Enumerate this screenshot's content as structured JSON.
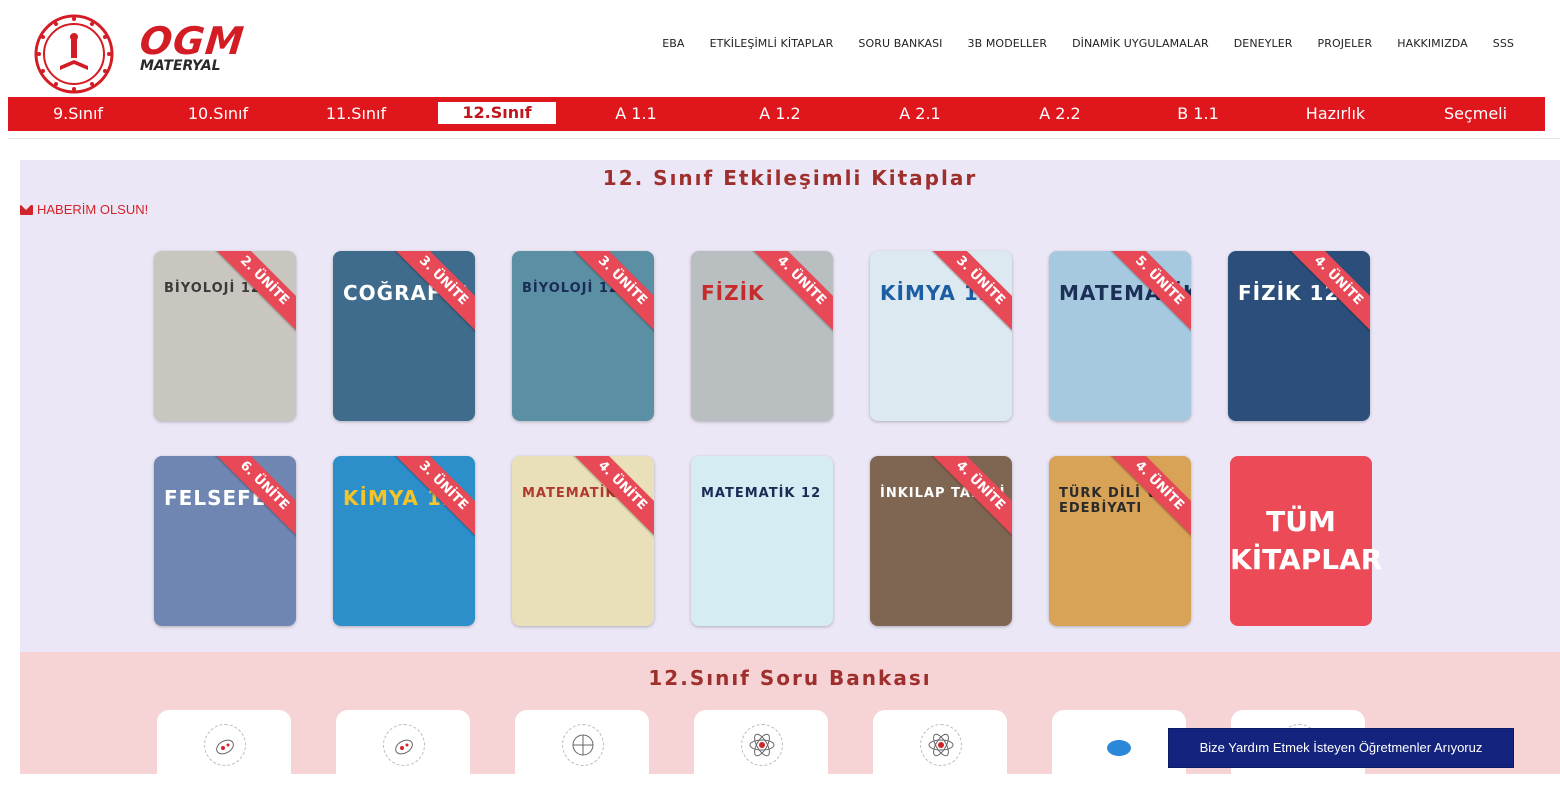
{
  "brand": {
    "name": "OGM",
    "sub": "MATERYAL"
  },
  "topnav": [
    "EBA",
    "ETKİLEŞİMLİ KİTAPLAR",
    "SORU BANKASI",
    "3B MODELLER",
    "DİNAMİK UYGULAMALAR",
    "DENEYLER",
    "PROJELER",
    "HAKKIMIZDA",
    "SSS"
  ],
  "grades": [
    "9.Sınıf",
    "10.Sınıf",
    "11.Sınıf",
    "12.Sınıf",
    "A 1.1",
    "A 1.2",
    "A 2.1",
    "A 2.2",
    "B 1.1",
    "Hazırlık",
    "Seçmeli"
  ],
  "active_grade": "12.Sınıf",
  "books_section": {
    "title": "12. Sınıf Etkileşimli Kitaplar",
    "notify": "HABERİM OLSUN!",
    "row1": [
      {
        "cover": "BİYOLOJİ 12",
        "ribbon": "2. ÜNİTE",
        "bg": "#c9c6c0",
        "fg": "#3b3b3b"
      },
      {
        "cover": "COĞRAFYA",
        "ribbon": "3. ÜNİTE",
        "bg": "#3f6c8d",
        "fg": "#ffffff"
      },
      {
        "cover": "BİYOLOJİ 12",
        "ribbon": "3. ÜNİTE",
        "bg": "#5b8fa3",
        "fg": "#1a2c55"
      },
      {
        "cover": "FİZİK",
        "ribbon": "4. ÜNİTE",
        "bg": "#b9bec0",
        "fg": "#c62a2a"
      },
      {
        "cover": "KİMYA 12",
        "ribbon": "3. ÜNİTE",
        "bg": "#dde9f1",
        "fg": "#1b5ea3"
      },
      {
        "cover": "MATEMATİK",
        "ribbon": "5. ÜNİTE",
        "bg": "#a7c9e0",
        "fg": "#1b2f57"
      },
      {
        "cover": "FİZİK 12",
        "ribbon": "4. ÜNİTE",
        "bg": "#2b4f7a",
        "fg": "#ffffff"
      }
    ],
    "row2": [
      {
        "cover": "FELSEFE",
        "ribbon": "6. ÜNİTE",
        "bg": "#6f86b3",
        "fg": "#ffffff"
      },
      {
        "cover": "KİMYA 12",
        "ribbon": "3. ÜNİTE",
        "bg": "#2d8fc9",
        "fg": "#f3c52a"
      },
      {
        "cover": "MATEMATİK 12",
        "ribbon": "4. ÜNİTE",
        "bg": "#e9dfb8",
        "fg": "#b03930"
      },
      {
        "cover": "MATEMATİK 12",
        "ribbon": "",
        "bg": "#d6ecf3",
        "fg": "#1a2c55"
      },
      {
        "cover": "İNKILAP TARİHİ",
        "ribbon": "4. ÜNİTE",
        "bg": "#7f6652",
        "fg": "#ffffff"
      },
      {
        "cover": "TÜRK DİLİ VE EDEBİYATI",
        "ribbon": "4. ÜNİTE",
        "bg": "#d8a356",
        "fg": "#2a2a2a"
      }
    ],
    "all_books": [
      "TÜM",
      "KİTAPLAR"
    ]
  },
  "qbank_section": {
    "title": "12.Sınıf Soru Bankası",
    "icons": [
      "bacteria-icon",
      "bacteria-icon",
      "globe-icon",
      "atom-icon",
      "atom-icon",
      "speech-bubble-icon",
      "book-icon"
    ]
  },
  "help_button": "Bize Yardım Etmek İsteyen Öğretmenler Arıyoruz",
  "colors": {
    "brand_red": "#e0161d",
    "ribbon": "#e74957",
    "navy": "#14247e",
    "title": "#9f2f2d"
  }
}
